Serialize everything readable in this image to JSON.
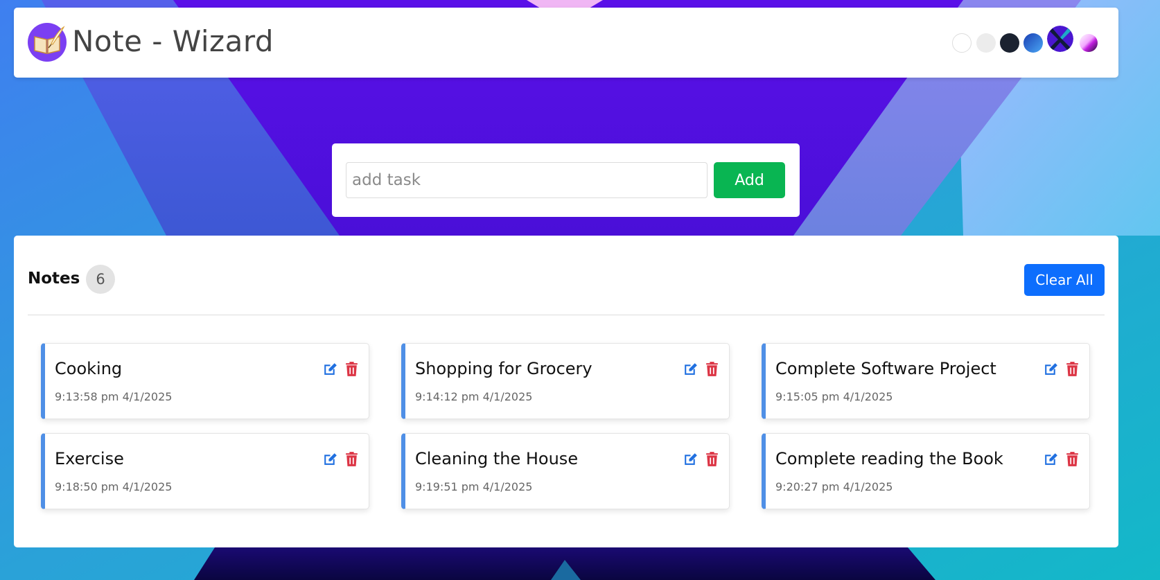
{
  "app": {
    "title": "Note - Wizard",
    "logo_icon": "book-quill-icon"
  },
  "themes": [
    {
      "name": "white",
      "color": "#ffffff"
    },
    {
      "name": "light-gray",
      "color": "#ececec"
    },
    {
      "name": "dark",
      "color": "#1b2230"
    },
    {
      "name": "blue-gradient",
      "color": "#3a7bd5"
    },
    {
      "name": "purple-x",
      "color": "#5b1be0"
    },
    {
      "name": "pink-gradient",
      "color": "#e04cf0"
    }
  ],
  "add_task": {
    "placeholder": "add task",
    "value": "",
    "button_label": "Add"
  },
  "notes_section": {
    "title": "Notes",
    "count": "6",
    "clear_label": "Clear All"
  },
  "notes": [
    {
      "title": "Cooking",
      "time": "9:13:58 pm 4/1/2025"
    },
    {
      "title": "Shopping for Grocery",
      "time": "9:14:12 pm 4/1/2025"
    },
    {
      "title": "Complete Software Project",
      "time": "9:15:05 pm 4/1/2025"
    },
    {
      "title": "Exercise",
      "time": "9:18:50 pm 4/1/2025"
    },
    {
      "title": "Cleaning the House",
      "time": "9:19:51 pm 4/1/2025"
    },
    {
      "title": "Complete reading the Book",
      "time": "9:20:27 pm 4/1/2025"
    }
  ],
  "colors": {
    "add_button": "#09b552",
    "clear_button": "#0d6efd",
    "edit_icon": "#1f6fe0",
    "delete_icon": "#dc3545",
    "note_accent": "#4f8fe6"
  },
  "icons": {
    "edit": "edit-icon",
    "delete": "trash-icon"
  }
}
